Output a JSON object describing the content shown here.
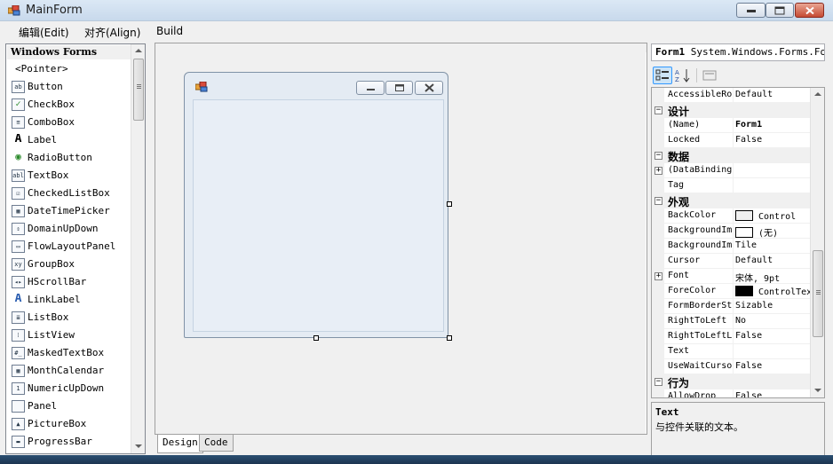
{
  "window": {
    "title": "MainForm"
  },
  "menu": {
    "items": [
      "编辑(Edit)",
      "对齐(Align)",
      "Build"
    ]
  },
  "toolbox": {
    "header": "Windows Forms",
    "items": [
      {
        "label": "<Pointer>",
        "icon": "pointer-icon"
      },
      {
        "label": "Button",
        "icon": "button-icon"
      },
      {
        "label": "CheckBox",
        "icon": "checkbox-icon"
      },
      {
        "label": "ComboBox",
        "icon": "combobox-icon"
      },
      {
        "label": "Label",
        "icon": "label-icon"
      },
      {
        "label": "RadioButton",
        "icon": "radiobutton-icon"
      },
      {
        "label": "TextBox",
        "icon": "textbox-icon"
      },
      {
        "label": "CheckedListBox",
        "icon": "checkedlistbox-icon"
      },
      {
        "label": "DateTimePicker",
        "icon": "datetimepicker-icon"
      },
      {
        "label": "DomainUpDown",
        "icon": "domainupdown-icon"
      },
      {
        "label": "FlowLayoutPanel",
        "icon": "flowlayoutpanel-icon"
      },
      {
        "label": "GroupBox",
        "icon": "groupbox-icon"
      },
      {
        "label": "HScrollBar",
        "icon": "hscrollbar-icon"
      },
      {
        "label": "LinkLabel",
        "icon": "linklabel-icon"
      },
      {
        "label": "ListBox",
        "icon": "listbox-icon"
      },
      {
        "label": "ListView",
        "icon": "listview-icon"
      },
      {
        "label": "MaskedTextBox",
        "icon": "maskedtextbox-icon"
      },
      {
        "label": "MonthCalendar",
        "icon": "monthcalendar-icon"
      },
      {
        "label": "NumericUpDown",
        "icon": "numericupdown-icon"
      },
      {
        "label": "Panel",
        "icon": "panel-icon"
      },
      {
        "label": "PictureBox",
        "icon": "picturebox-icon"
      },
      {
        "label": "ProgressBar",
        "icon": "progressbar-icon"
      }
    ]
  },
  "designer": {
    "tabs": [
      "Design",
      "Code"
    ]
  },
  "properties": {
    "object_name": "Form1",
    "object_type": "System.Windows.Forms.Form",
    "rows": [
      {
        "kind": "prop",
        "name": "AccessibleRole",
        "value": "Default"
      },
      {
        "kind": "cat",
        "name": "设计"
      },
      {
        "kind": "prop",
        "name": "(Name)",
        "value": "Form1",
        "bold": true
      },
      {
        "kind": "prop",
        "name": "Locked",
        "value": "False"
      },
      {
        "kind": "cat",
        "name": "数据"
      },
      {
        "kind": "prop",
        "name": "(DataBindings)",
        "value": "",
        "expand": true
      },
      {
        "kind": "prop",
        "name": "Tag",
        "value": ""
      },
      {
        "kind": "cat",
        "name": "外观"
      },
      {
        "kind": "prop",
        "name": "BackColor",
        "value": "Control",
        "swatch": "#f0f0f0"
      },
      {
        "kind": "prop",
        "name": "BackgroundImage",
        "value": "(无)",
        "swatch": "#ffffff"
      },
      {
        "kind": "prop",
        "name": "BackgroundImageLayout",
        "value": "Tile"
      },
      {
        "kind": "prop",
        "name": "Cursor",
        "value": "Default"
      },
      {
        "kind": "prop",
        "name": "Font",
        "value": "宋体, 9pt",
        "expand": true
      },
      {
        "kind": "prop",
        "name": "ForeColor",
        "value": "ControlText",
        "swatch": "#000000"
      },
      {
        "kind": "prop",
        "name": "FormBorderStyle",
        "value": "Sizable"
      },
      {
        "kind": "prop",
        "name": "RightToLeft",
        "value": "No"
      },
      {
        "kind": "prop",
        "name": "RightToLeftLayout",
        "value": "False"
      },
      {
        "kind": "prop",
        "name": "Text",
        "value": ""
      },
      {
        "kind": "prop",
        "name": "UseWaitCursor",
        "value": "False"
      },
      {
        "kind": "cat",
        "name": "行为"
      },
      {
        "kind": "prop",
        "name": "AllowDrop",
        "value": "False"
      }
    ],
    "description_title": "Text",
    "description_text": "与控件关联的文本。"
  },
  "colors": {
    "accent": "#3399ff",
    "panel": "#f0f0f0",
    "border": "#a0a0a0"
  }
}
